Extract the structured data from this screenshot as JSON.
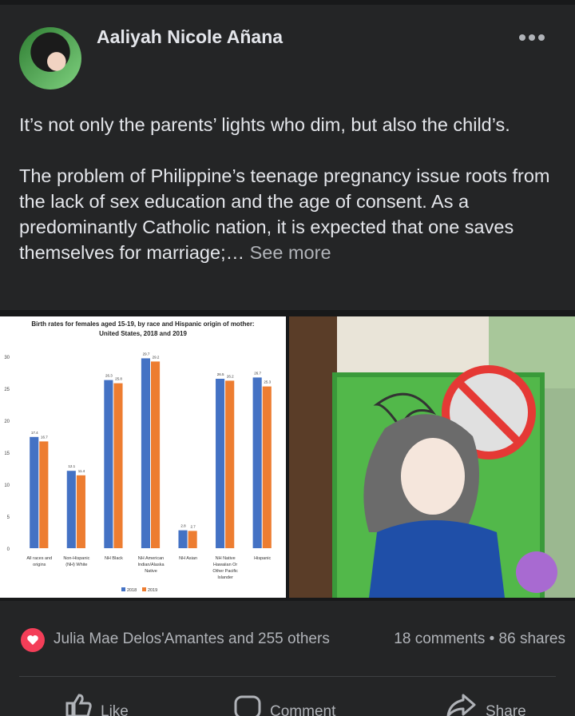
{
  "post": {
    "author": "Aaliyah Nicole Añana",
    "more_icon": "more-horizontal-icon",
    "paragraphs": [
      "It’s not only the parents’ lights who dim, but also the child’s.",
      "The problem of Philippine’s teenage pregnancy issue roots from the lack of sex education and the age of consent. As a predominantly Catholic nation, it is expected that one saves themselves for marriage;…"
    ],
    "see_more": "See more"
  },
  "chart_data": {
    "type": "bar",
    "title": "Birth rates for females aged 15-19, by race and Hispanic origin of mother:",
    "subtitle": "United States, 2018 and 2019",
    "categories": [
      "All races and origins",
      "Non-Hispanic (NH) White",
      "NH Black",
      "NH American Indian/Alaska Native",
      "NH Asian",
      "NH Native Hawaiian Or Other Pacific Islander",
      "Hispanic"
    ],
    "category_lines": [
      [
        "All races and",
        "origins"
      ],
      [
        "Non-Hispanic",
        "(NH) White"
      ],
      [
        "NH Black"
      ],
      [
        "NH American",
        "Indian/Alaska",
        "Native"
      ],
      [
        "NH Asian"
      ],
      [
        "NH Native",
        "Hawaiian Or",
        "Other Pacific",
        "Islander"
      ],
      [
        "Hispanic"
      ]
    ],
    "series": [
      {
        "name": "2018",
        "color": "#4472c4",
        "values": [
          17.4,
          12.1,
          26.3,
          29.7,
          2.8,
          26.5,
          26.7
        ]
      },
      {
        "name": "2019",
        "color": "#ed7d31",
        "values": [
          16.7,
          11.4,
          25.8,
          29.2,
          2.7,
          26.2,
          25.3
        ]
      }
    ],
    "ylim": [
      0,
      30
    ],
    "yticks": [
      0,
      5,
      10,
      15,
      20,
      25,
      30
    ],
    "legend": "bottom",
    "grid": false
  },
  "reactions": {
    "icon": "love-reaction-icon",
    "text": "Julia Mae Delos'Amantes and 255 others",
    "comments": "18 comments",
    "separator": "•",
    "shares": "86 shares"
  },
  "actions": {
    "like": "Like",
    "comment": "Comment",
    "share": "Share"
  }
}
